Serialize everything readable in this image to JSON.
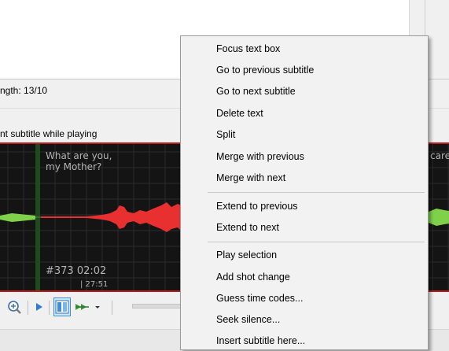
{
  "line_length": "ngth: 13/10",
  "checkbox_label": "nt subtitle while playing",
  "waveform": {
    "subtitle_text_left": "What are you,\nmy Mother?",
    "subtitle_text_right": "care",
    "subtitle_number": "#373  02:02",
    "time_marker": "| 27:51",
    "colors": {
      "background": "#141414",
      "grid": "#2c2c2c",
      "wave": "#7fd14a",
      "selected_wave": "#e83030",
      "border": "#b81e1e",
      "cursor": "#2f6b2f"
    }
  },
  "toolbar": {
    "icons": [
      "zoom-icon",
      "play-icon",
      "waveform-spectrogram-toggle-icon",
      "play-next-icon",
      "dropdown-arrow-icon"
    ]
  },
  "context_menu": {
    "items": [
      "Focus text box",
      "Go to previous subtitle",
      "Go to next subtitle",
      "Delete text",
      "Split",
      "Merge with previous",
      "Merge with next",
      "Extend to previous",
      "Extend to next",
      "Play selection",
      "Add shot change",
      "Guess time codes...",
      "Seek silence...",
      "Insert subtitle here..."
    ]
  }
}
